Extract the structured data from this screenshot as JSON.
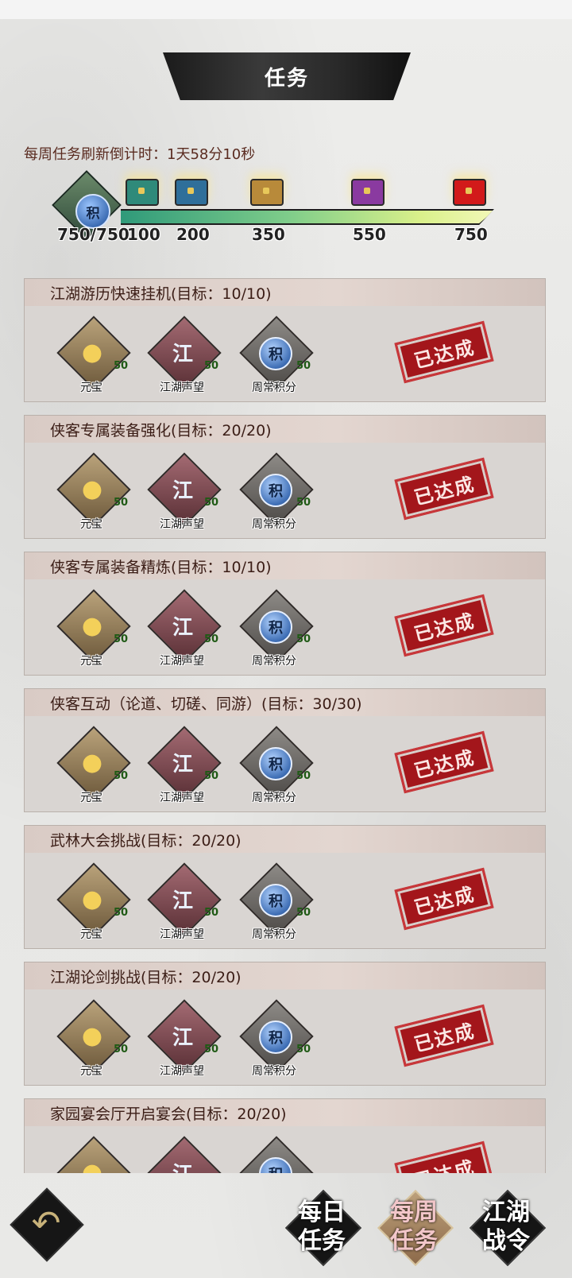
{
  "header": {
    "title": "任务"
  },
  "countdown": {
    "label": "每周任务刷新倒计时：",
    "value": "1天58分10秒"
  },
  "progress": {
    "coin_glyph": "积",
    "current_text": "750/750",
    "fill_fraction": 1.0,
    "milestones": [
      {
        "value": "100",
        "chest_color": "#2f8a7a"
      },
      {
        "value": "200",
        "chest_color": "#2f6f9a"
      },
      {
        "value": "350",
        "chest_color": "#b88a3a"
      },
      {
        "value": "550",
        "chest_color": "#8a3aa0"
      },
      {
        "value": "750",
        "chest_color": "#d21a1a"
      }
    ]
  },
  "rewards": {
    "ingot": {
      "name": "元宝",
      "qty": "50",
      "icon": "gold-ingot-icon"
    },
    "flag": {
      "name": "江湖声望",
      "qty": "50",
      "glyph": "江",
      "icon": "flag-icon"
    },
    "point": {
      "name": "周常积分",
      "qty": "50",
      "glyph": "积",
      "icon": "coin-icon"
    }
  },
  "stamp_label": "已达成",
  "tasks": [
    {
      "title": "江湖游历快速挂机(目标：10/10)"
    },
    {
      "title": "侠客专属装备强化(目标：20/20)"
    },
    {
      "title": "侠客专属装备精炼(目标：10/10)"
    },
    {
      "title": "侠客互动（论道、切磋、同游）(目标：30/30)"
    },
    {
      "title": "武林大会挑战(目标：20/20)"
    },
    {
      "title": "江湖论剑挑战(目标：20/20)"
    },
    {
      "title": "家园宴会厅开启宴会(目标：20/20)"
    }
  ],
  "bottom_tabs": [
    {
      "line1": "每日",
      "line2": "任务",
      "active": false
    },
    {
      "line1": "每周",
      "line2": "任务",
      "active": true
    },
    {
      "line1": "江湖",
      "line2": "战令",
      "active": false
    }
  ],
  "back_glyph": "↶"
}
